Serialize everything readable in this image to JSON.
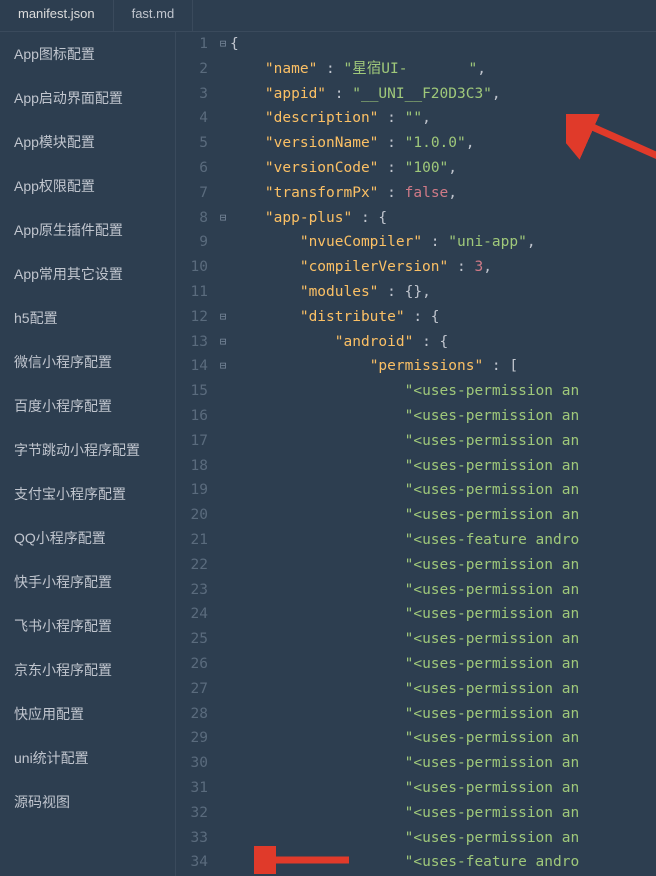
{
  "tabs": [
    {
      "label": "manifest.json"
    },
    {
      "label": "fast.md"
    }
  ],
  "sidebar": {
    "items": [
      {
        "label": "App图标配置"
      },
      {
        "label": "App启动界面配置"
      },
      {
        "label": "App模块配置"
      },
      {
        "label": "App权限配置"
      },
      {
        "label": "App原生插件配置"
      },
      {
        "label": "App常用其它设置"
      },
      {
        "label": "h5配置"
      },
      {
        "label": "微信小程序配置"
      },
      {
        "label": "百度小程序配置"
      },
      {
        "label": "字节跳动小程序配置"
      },
      {
        "label": "支付宝小程序配置"
      },
      {
        "label": "QQ小程序配置"
      },
      {
        "label": "快手小程序配置"
      },
      {
        "label": "飞书小程序配置"
      },
      {
        "label": "京东小程序配置"
      },
      {
        "label": "快应用配置"
      },
      {
        "label": "uni统计配置"
      },
      {
        "label": "源码视图"
      }
    ]
  },
  "code": {
    "lines": [
      {
        "n": 1,
        "fold": "⊟",
        "tokens": [
          [
            "p",
            "{"
          ]
        ]
      },
      {
        "n": 2,
        "fold": "",
        "tokens": [
          [
            "p",
            "    "
          ],
          [
            "k",
            "\"name\""
          ],
          [
            "p",
            " : "
          ],
          [
            "s",
            "\"星宿UI-       \""
          ],
          [
            "p",
            ","
          ]
        ]
      },
      {
        "n": 3,
        "fold": "",
        "tokens": [
          [
            "p",
            "    "
          ],
          [
            "k",
            "\"appid\""
          ],
          [
            "p",
            " : "
          ],
          [
            "s",
            "\"__UNI__F20D3C3\""
          ],
          [
            "p",
            ","
          ]
        ]
      },
      {
        "n": 4,
        "fold": "",
        "tokens": [
          [
            "p",
            "    "
          ],
          [
            "k",
            "\"description\""
          ],
          [
            "p",
            " : "
          ],
          [
            "s",
            "\"\""
          ],
          [
            "p",
            ","
          ]
        ]
      },
      {
        "n": 5,
        "fold": "",
        "tokens": [
          [
            "p",
            "    "
          ],
          [
            "k",
            "\"versionName\""
          ],
          [
            "p",
            " : "
          ],
          [
            "s",
            "\"1.0.0\""
          ],
          [
            "p",
            ","
          ]
        ]
      },
      {
        "n": 6,
        "fold": "",
        "tokens": [
          [
            "p",
            "    "
          ],
          [
            "k",
            "\"versionCode\""
          ],
          [
            "p",
            " : "
          ],
          [
            "s",
            "\"100\""
          ],
          [
            "p",
            ","
          ]
        ]
      },
      {
        "n": 7,
        "fold": "",
        "tokens": [
          [
            "p",
            "    "
          ],
          [
            "k",
            "\"transformPx\""
          ],
          [
            "p",
            " : "
          ],
          [
            "b",
            "false"
          ],
          [
            "p",
            ","
          ]
        ]
      },
      {
        "n": 8,
        "fold": "⊟",
        "tokens": [
          [
            "p",
            "    "
          ],
          [
            "k",
            "\"app-plus\""
          ],
          [
            "p",
            " : {"
          ]
        ]
      },
      {
        "n": 9,
        "fold": "",
        "tokens": [
          [
            "p",
            "        "
          ],
          [
            "k",
            "\"nvueCompiler\""
          ],
          [
            "p",
            " : "
          ],
          [
            "s",
            "\"uni-app\""
          ],
          [
            "p",
            ","
          ]
        ]
      },
      {
        "n": 10,
        "fold": "",
        "tokens": [
          [
            "p",
            "        "
          ],
          [
            "k",
            "\"compilerVersion\""
          ],
          [
            "p",
            " : "
          ],
          [
            "n",
            "3"
          ],
          [
            "p",
            ","
          ]
        ]
      },
      {
        "n": 11,
        "fold": "",
        "tokens": [
          [
            "p",
            "        "
          ],
          [
            "k",
            "\"modules\""
          ],
          [
            "p",
            " : {},"
          ]
        ]
      },
      {
        "n": 12,
        "fold": "⊟",
        "tokens": [
          [
            "p",
            "        "
          ],
          [
            "k",
            "\"distribute\""
          ],
          [
            "p",
            " : {"
          ]
        ]
      },
      {
        "n": 13,
        "fold": "⊟",
        "tokens": [
          [
            "p",
            "            "
          ],
          [
            "k",
            "\"android\""
          ],
          [
            "p",
            " : {"
          ]
        ]
      },
      {
        "n": 14,
        "fold": "⊟",
        "tokens": [
          [
            "p",
            "                "
          ],
          [
            "k",
            "\"permissions\""
          ],
          [
            "p",
            " : ["
          ]
        ]
      },
      {
        "n": 15,
        "fold": "",
        "tokens": [
          [
            "p",
            "                    "
          ],
          [
            "s",
            "\"<uses-permission an"
          ]
        ]
      },
      {
        "n": 16,
        "fold": "",
        "tokens": [
          [
            "p",
            "                    "
          ],
          [
            "s",
            "\"<uses-permission an"
          ]
        ]
      },
      {
        "n": 17,
        "fold": "",
        "tokens": [
          [
            "p",
            "                    "
          ],
          [
            "s",
            "\"<uses-permission an"
          ]
        ]
      },
      {
        "n": 18,
        "fold": "",
        "tokens": [
          [
            "p",
            "                    "
          ],
          [
            "s",
            "\"<uses-permission an"
          ]
        ]
      },
      {
        "n": 19,
        "fold": "",
        "tokens": [
          [
            "p",
            "                    "
          ],
          [
            "s",
            "\"<uses-permission an"
          ]
        ]
      },
      {
        "n": 20,
        "fold": "",
        "tokens": [
          [
            "p",
            "                    "
          ],
          [
            "s",
            "\"<uses-permission an"
          ]
        ]
      },
      {
        "n": 21,
        "fold": "",
        "tokens": [
          [
            "p",
            "                    "
          ],
          [
            "s",
            "\"<uses-feature andro"
          ]
        ]
      },
      {
        "n": 22,
        "fold": "",
        "tokens": [
          [
            "p",
            "                    "
          ],
          [
            "s",
            "\"<uses-permission an"
          ]
        ]
      },
      {
        "n": 23,
        "fold": "",
        "tokens": [
          [
            "p",
            "                    "
          ],
          [
            "s",
            "\"<uses-permission an"
          ]
        ]
      },
      {
        "n": 24,
        "fold": "",
        "tokens": [
          [
            "p",
            "                    "
          ],
          [
            "s",
            "\"<uses-permission an"
          ]
        ]
      },
      {
        "n": 25,
        "fold": "",
        "tokens": [
          [
            "p",
            "                    "
          ],
          [
            "s",
            "\"<uses-permission an"
          ]
        ]
      },
      {
        "n": 26,
        "fold": "",
        "tokens": [
          [
            "p",
            "                    "
          ],
          [
            "s",
            "\"<uses-permission an"
          ]
        ]
      },
      {
        "n": 27,
        "fold": "",
        "tokens": [
          [
            "p",
            "                    "
          ],
          [
            "s",
            "\"<uses-permission an"
          ]
        ]
      },
      {
        "n": 28,
        "fold": "",
        "tokens": [
          [
            "p",
            "                    "
          ],
          [
            "s",
            "\"<uses-permission an"
          ]
        ]
      },
      {
        "n": 29,
        "fold": "",
        "tokens": [
          [
            "p",
            "                    "
          ],
          [
            "s",
            "\"<uses-permission an"
          ]
        ]
      },
      {
        "n": 30,
        "fold": "",
        "tokens": [
          [
            "p",
            "                    "
          ],
          [
            "s",
            "\"<uses-permission an"
          ]
        ]
      },
      {
        "n": 31,
        "fold": "",
        "tokens": [
          [
            "p",
            "                    "
          ],
          [
            "s",
            "\"<uses-permission an"
          ]
        ]
      },
      {
        "n": 32,
        "fold": "",
        "tokens": [
          [
            "p",
            "                    "
          ],
          [
            "s",
            "\"<uses-permission an"
          ]
        ]
      },
      {
        "n": 33,
        "fold": "",
        "tokens": [
          [
            "p",
            "                    "
          ],
          [
            "s",
            "\"<uses-permission an"
          ]
        ]
      },
      {
        "n": 34,
        "fold": "",
        "tokens": [
          [
            "p",
            "                    "
          ],
          [
            "s",
            "\"<uses-feature andro"
          ]
        ]
      }
    ]
  }
}
